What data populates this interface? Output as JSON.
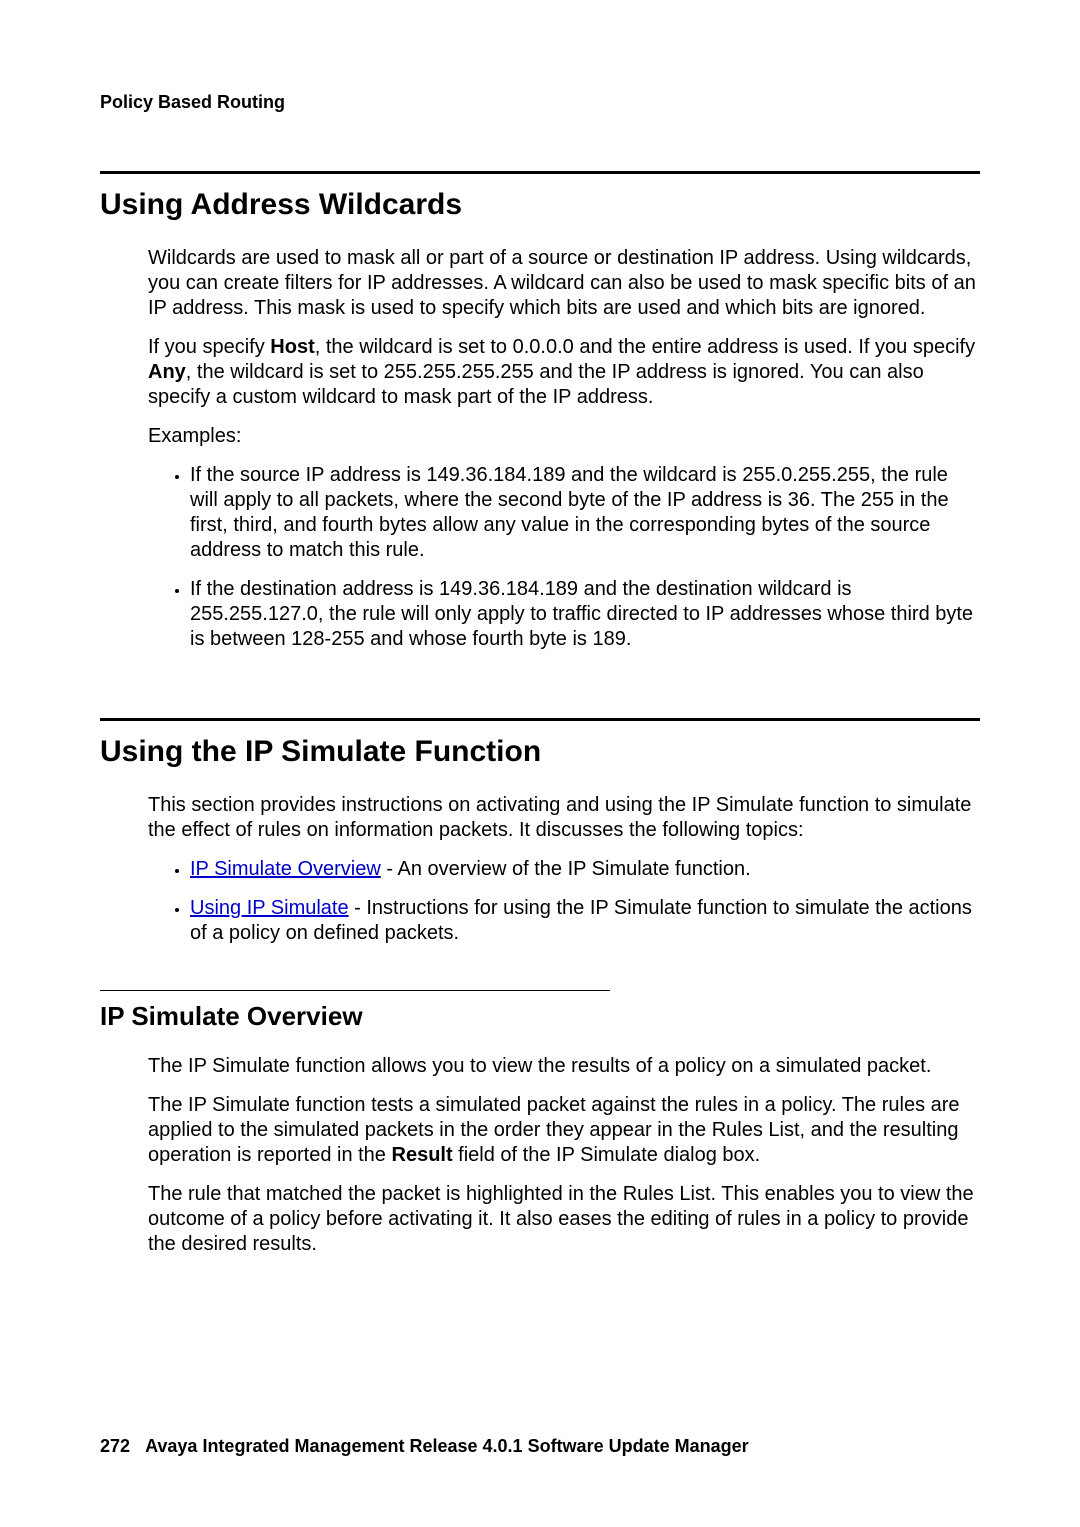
{
  "header": {
    "title": "Policy Based Routing"
  },
  "section1": {
    "heading": "Using Address Wildcards",
    "para1": "Wildcards are used to mask all or part of a source or destination IP address. Using wildcards, you can create filters for IP addresses. A wildcard can also be used to mask specific bits of an IP address. This mask is used to specify which bits are used and which bits are ignored.",
    "para2_pre": "If you specify ",
    "para2_b1": "Host",
    "para2_mid": ", the wildcard is set to 0.0.0.0 and the entire address is used. If you specify ",
    "para2_b2": "Any",
    "para2_post": ", the wildcard is set to 255.255.255.255 and the IP address is ignored. You can also specify a custom wildcard to mask part of the IP address.",
    "examples_label": "Examples:",
    "bullets": [
      "If the source IP address is 149.36.184.189 and the wildcard is 255.0.255.255, the rule will apply to all packets, where the second byte of the IP address is 36. The 255 in the first, third, and fourth bytes allow any value in the corresponding bytes of the source address to match this rule.",
      "If the destination address is 149.36.184.189 and the destination wildcard is 255.255.127.0, the rule will only apply to traffic directed to IP addresses whose third byte is between 128-255 and whose fourth byte is 189."
    ]
  },
  "section2": {
    "heading": "Using the IP Simulate Function",
    "para1": "This section provides instructions on activating and using the IP Simulate function to simulate the effect of rules on information packets. It discusses the following topics:",
    "bullets": [
      {
        "link": "IP Simulate Overview",
        "rest": " - An overview of the IP Simulate function."
      },
      {
        "link": "Using IP Simulate",
        "rest": " - Instructions for using the IP Simulate function to simulate the actions of a policy on defined packets."
      }
    ]
  },
  "section3": {
    "heading": "IP Simulate Overview",
    "para1": "The IP Simulate function allows you to view the results of a policy on a simulated packet.",
    "para2_pre": "The IP Simulate function tests a simulated packet against the rules in a policy. The rules are applied to the simulated packets in the order they appear in the Rules List, and the resulting operation is reported in the ",
    "para2_b1": "Result",
    "para2_post": " field of the IP Simulate dialog box.",
    "para3": "The rule that matched the packet is highlighted in the Rules List. This enables you to view the outcome of a policy before activating it. It also eases the editing of rules in a policy to provide the desired results."
  },
  "footer": {
    "page_number": "272",
    "doc_title": "Avaya Integrated Management Release 4.0.1 Software Update Manager"
  }
}
